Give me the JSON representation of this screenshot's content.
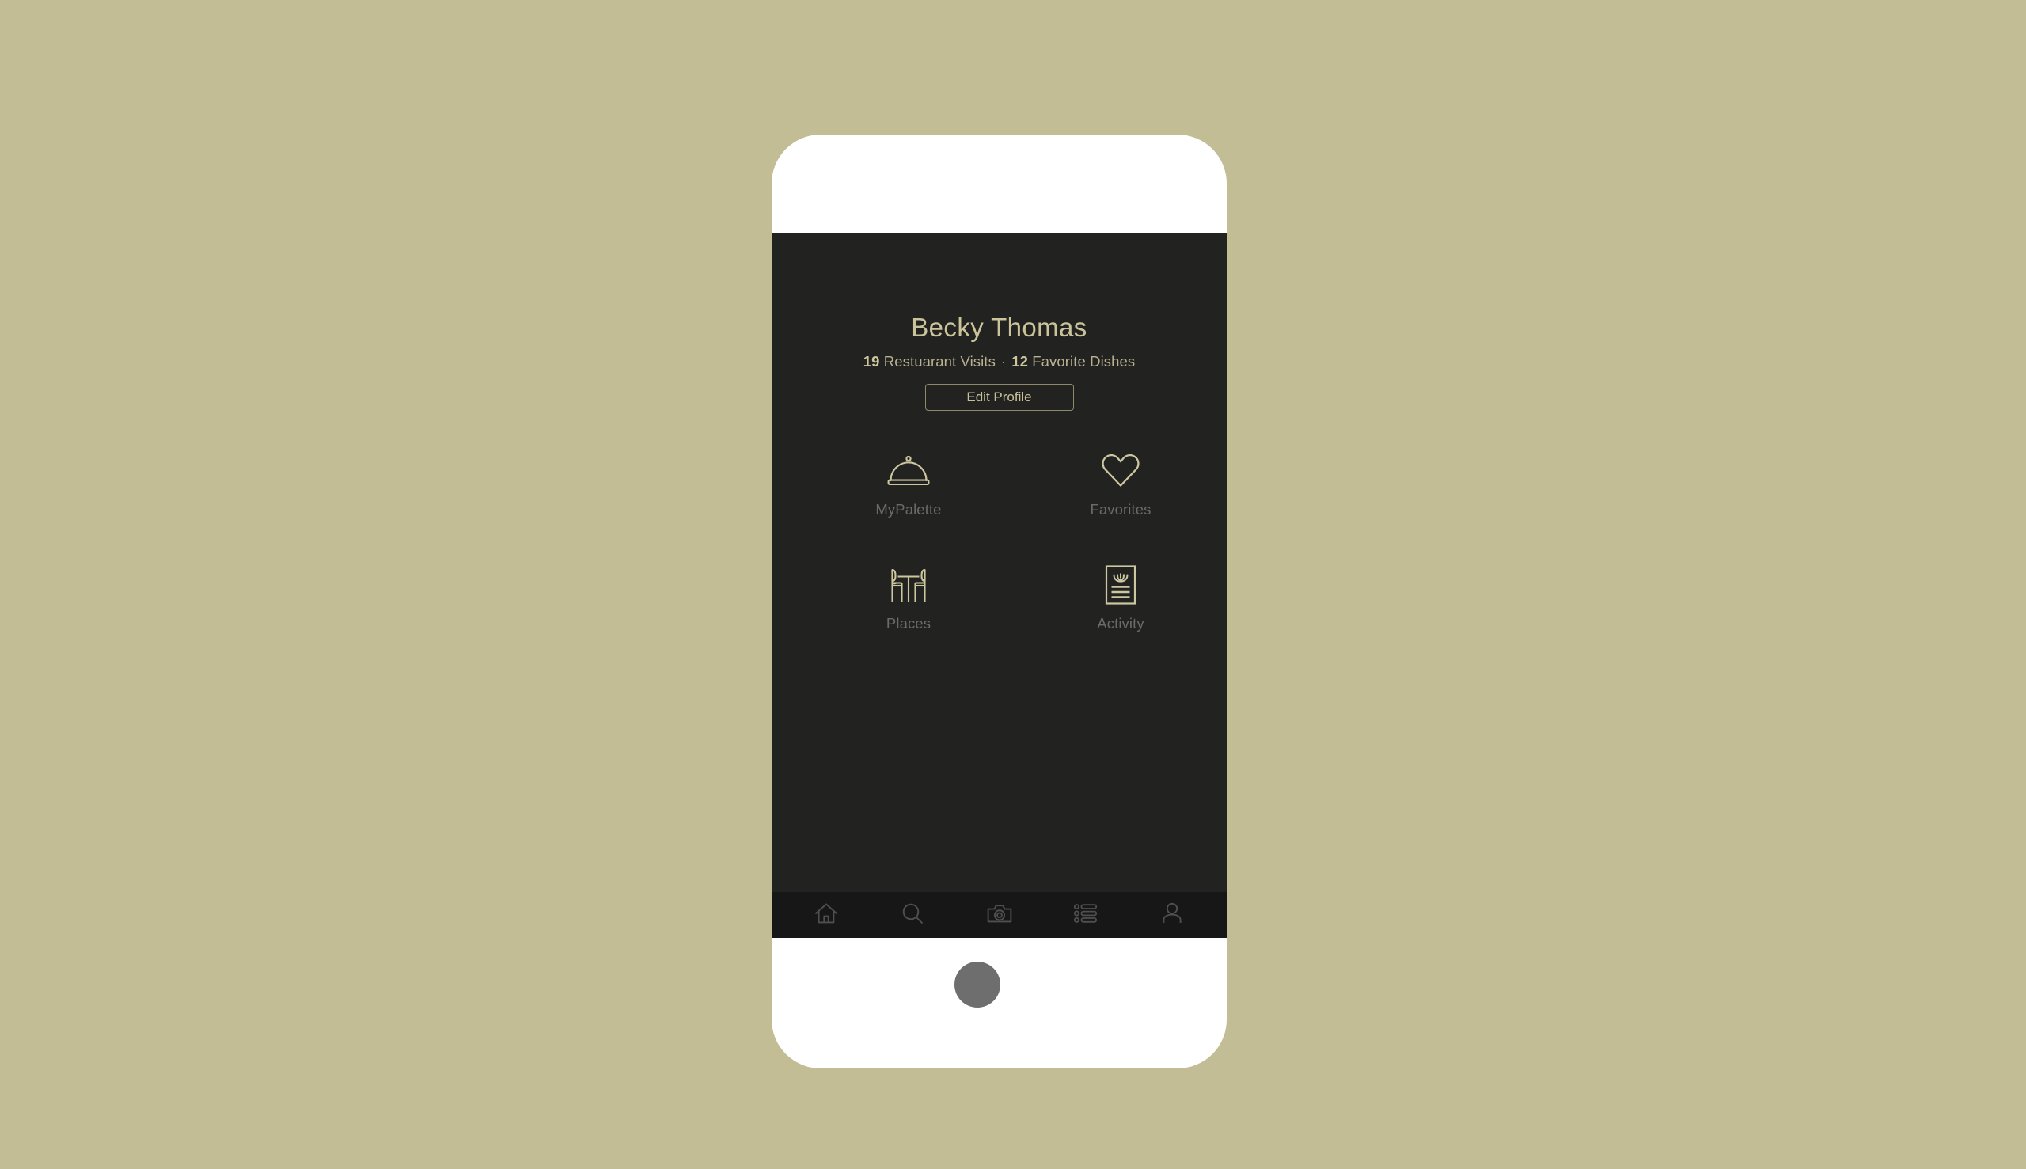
{
  "theme": {
    "page_background": "#c3bd95",
    "screen_background": "#222221",
    "tabbar_background": "#171717",
    "accent_khaki": "#cbc49b",
    "icon_khaki": "#cdc7a0",
    "muted_label": "#6b6b69",
    "tab_icon": "#4d4d4d",
    "home_button": "#6e6e6e",
    "bezel": "#ffffff"
  },
  "profile": {
    "name": "Becky Thomas",
    "stats": {
      "visits_count": "19",
      "visits_label": "Restuarant Visits",
      "separator": "·",
      "favorites_count": "12",
      "favorites_label": "Favorite Dishes"
    },
    "edit_button_label": "Edit Profile"
  },
  "feature_grid": {
    "items": [
      {
        "label": "MyPalette",
        "icon": "cloche-icon"
      },
      {
        "label": "Favorites",
        "icon": "heart-icon"
      },
      {
        "label": "Places",
        "icon": "table-chairs-icon"
      },
      {
        "label": "Activity",
        "icon": "menu-card-icon"
      }
    ]
  },
  "tab_bar": {
    "items": [
      {
        "name": "home",
        "icon": "home-icon"
      },
      {
        "name": "search",
        "icon": "search-icon"
      },
      {
        "name": "camera",
        "icon": "camera-icon"
      },
      {
        "name": "feed",
        "icon": "list-icon"
      },
      {
        "name": "profile",
        "icon": "person-icon"
      }
    ]
  },
  "device": {
    "home_button": "home-button"
  }
}
